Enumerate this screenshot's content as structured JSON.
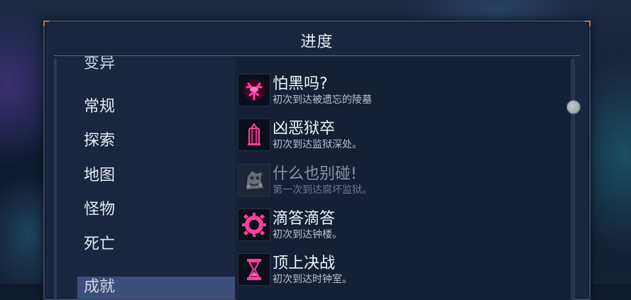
{
  "window": {
    "title": "进度"
  },
  "categories": [
    {
      "label": "变异",
      "partial": true
    },
    {
      "label": "常规"
    },
    {
      "label": "探索"
    },
    {
      "label": "地图"
    },
    {
      "label": "怪物"
    },
    {
      "label": "死亡"
    },
    {
      "label": "成就",
      "partial": true,
      "selected": true
    }
  ],
  "achievements": [
    {
      "name": "怕黑吗?",
      "description": "初次到达被遗忘的陵墓",
      "icon": "tree-icon",
      "unlocked": true
    },
    {
      "name": "凶恶狱卒",
      "description": "初次到达监狱深处。",
      "icon": "lantern-icon",
      "unlocked": true
    },
    {
      "name": "什么也别碰!",
      "description": "第一次到达腐坏监狱。",
      "icon": "rotten-creature-icon",
      "unlocked": false
    },
    {
      "name": "滴答滴答",
      "description": "初次到达钟楼。",
      "icon": "gear-icon",
      "unlocked": true
    },
    {
      "name": "顶上决战",
      "description": "初次到达时钟室。",
      "icon": "hourglass-icon",
      "unlocked": true
    }
  ],
  "colors": {
    "accent": "#ff2a8c",
    "locked": "#8a93a8"
  }
}
